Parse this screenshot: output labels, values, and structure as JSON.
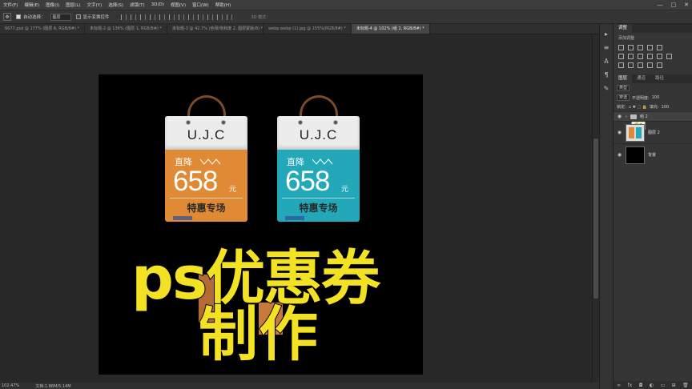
{
  "menu": [
    "文件(F)",
    "编辑(E)",
    "图像(I)",
    "图层(L)",
    "文字(Y)",
    "选择(S)",
    "滤镜(T)",
    "3D(D)",
    "视图(V)",
    "窗口(W)",
    "帮助(H)"
  ],
  "window_controls": [
    "—",
    "□",
    "✕"
  ],
  "options": {
    "auto_select_label": "自动选择：",
    "auto_select_value": "图层",
    "show_transform_label": "显示变换控件",
    "mode_3d_label": "3D 模式："
  },
  "tabs": [
    "6677.psd @ 177% (图层 8, RGB/8#) *",
    "未标题-2 @ 136% (图层 1, RGB/8#) *",
    "未标题-3 @ 42.7% (色相/饱和度 2, 图层蒙版/8) *",
    "webp.webp (1).jpg @ 155%(RGB/8#) *",
    "未标题-4 @ 102% (组 2, RGB/8#) *"
  ],
  "active_tab": 4,
  "artwork": {
    "bags": [
      {
        "brand": "U.J.C",
        "drop": "直降",
        "price": "658",
        "unit": "元",
        "special": "特惠专场",
        "color": "#e08a35"
      },
      {
        "brand": "U.J.C",
        "drop": "直降",
        "price": "658",
        "unit": "元",
        "special": "特惠专场",
        "color": "#22a8b8"
      }
    ],
    "overlay_line1": "ps优惠券",
    "overlay_line2": "制作",
    "overlay_color": "#f3e224"
  },
  "status": {
    "zoom": "102.47%",
    "doc": "文档:1.88M/5.14M"
  },
  "panels": {
    "top_tab": "调整",
    "add_adjustment": "添加调整",
    "layer_tabs": [
      "图层",
      "通道",
      "路径"
    ],
    "kind_filter": "类型",
    "blend_mode": "穿透",
    "opacity_label": "不透明度:",
    "opacity_value": "100",
    "lock_label": "锁定:",
    "fill_label": "填充:",
    "fill_value": "100",
    "layers": [
      {
        "name": "组 2",
        "type": "group"
      },
      {
        "name": "图层 2",
        "type": "image"
      },
      {
        "name": "背景",
        "type": "background"
      }
    ],
    "tooltip": "组 2"
  }
}
